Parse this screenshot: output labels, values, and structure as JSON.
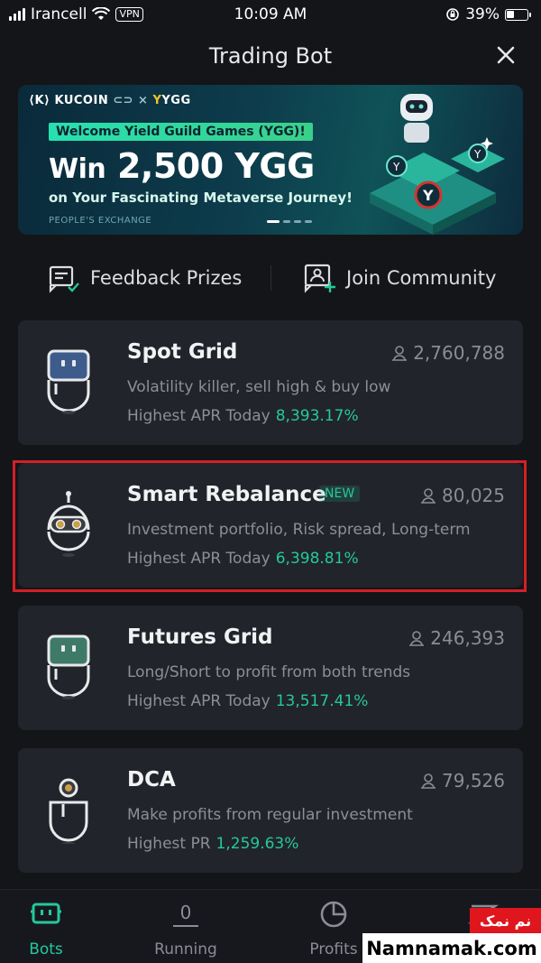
{
  "status_bar": {
    "carrier": "Irancell",
    "vpn": "VPN",
    "time": "10:09 AM",
    "battery": "39%"
  },
  "header": {
    "title": "Trading Bot"
  },
  "banner": {
    "brand": "KUCOIN",
    "partner": "YGG",
    "pill": "Welcome Yield Guild Games (YGG)!",
    "headline_prefix": "Win",
    "headline_amount": "2,500 YGG",
    "subline": "on Your Fascinating Metaverse Journey!",
    "footer": "PEOPLE'S EXCHANGE",
    "slides_total": 4,
    "slide_active": 1
  },
  "quick_links": {
    "feedback": "Feedback Prizes",
    "community": "Join Community"
  },
  "bots": [
    {
      "title": "Spot Grid",
      "users": "2,760,788",
      "description": "Volatility killer, sell high & buy low",
      "apr_label": "Highest APR Today",
      "apr_value": "8,393.17%",
      "icon": "spot-grid-robot-icon",
      "color": "#3d5c8c"
    },
    {
      "title": "Smart Rebalance",
      "badge": "NEW",
      "users": "80,025",
      "description": "Investment portfolio, Risk spread, Long-term",
      "apr_label": "Highest APR Today",
      "apr_value": "6,398.81%",
      "icon": "smart-rebalance-robot-icon",
      "color": "#c8a04a"
    },
    {
      "title": "Futures Grid",
      "users": "246,393",
      "description": "Long/Short to profit from both trends",
      "apr_label": "Highest APR Today",
      "apr_value": "13,517.41%",
      "icon": "futures-grid-robot-icon",
      "color": "#3f7a68"
    },
    {
      "title": "DCA",
      "users": "79,526",
      "description": "Make profits from regular investment",
      "apr_label": "Highest PR",
      "apr_value": "1,259.63%",
      "icon": "dca-robot-icon",
      "color": "#c8a04a"
    }
  ],
  "tabbar": {
    "bots": "Bots",
    "running_count": "0",
    "running": "Running",
    "profits": "Profits"
  },
  "watermark": {
    "fa": "نم نمک",
    "en": "Namnamak.com"
  },
  "colors": {
    "accent": "#24c99a",
    "background": "#141519",
    "card": "#22242b",
    "highlight": "#d41f26"
  }
}
